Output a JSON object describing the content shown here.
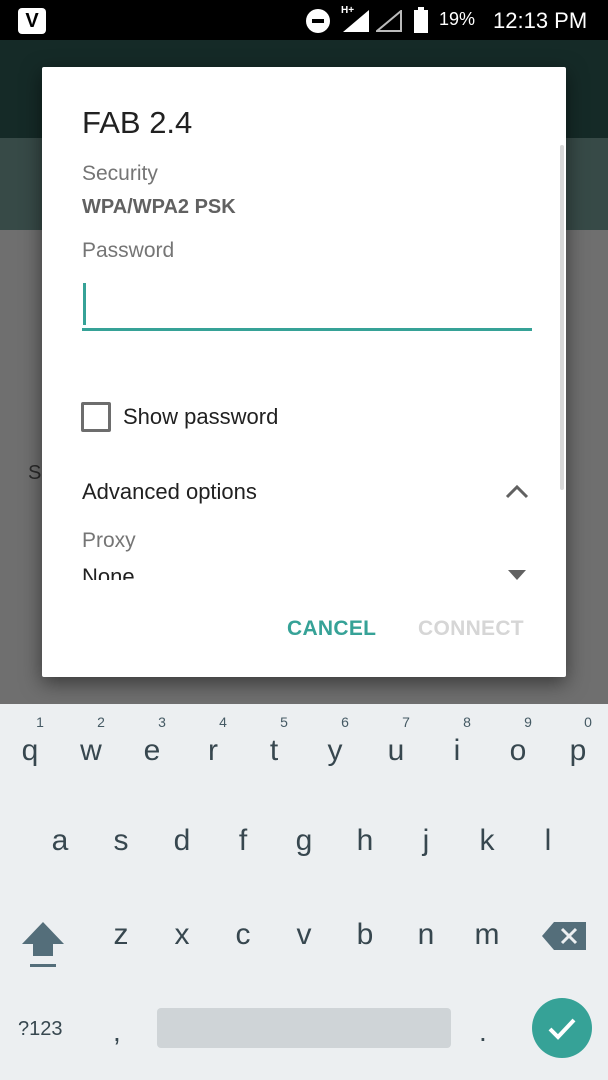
{
  "status_bar": {
    "app_badge": "V",
    "signal_label": "H+",
    "battery": "19%",
    "time": "12:13 PM"
  },
  "dialog": {
    "title": "FAB 2.4",
    "security_label": "Security",
    "security_value": "WPA/WPA2 PSK",
    "password_label": "Password",
    "password_value": "",
    "show_password_label": "Show password",
    "show_password_checked": false,
    "advanced_options_label": "Advanced options",
    "proxy_label": "Proxy",
    "proxy_value": "None",
    "cancel_label": "CANCEL",
    "connect_label": "CONNECT"
  },
  "keyboard": {
    "row1": [
      {
        "char": "q",
        "hint": "1"
      },
      {
        "char": "w",
        "hint": "2"
      },
      {
        "char": "e",
        "hint": "3"
      },
      {
        "char": "r",
        "hint": "4"
      },
      {
        "char": "t",
        "hint": "5"
      },
      {
        "char": "y",
        "hint": "6"
      },
      {
        "char": "u",
        "hint": "7"
      },
      {
        "char": "i",
        "hint": "8"
      },
      {
        "char": "o",
        "hint": "9"
      },
      {
        "char": "p",
        "hint": "0"
      }
    ],
    "row2": [
      "a",
      "s",
      "d",
      "f",
      "g",
      "h",
      "j",
      "k",
      "l"
    ],
    "row3": [
      "z",
      "x",
      "c",
      "v",
      "b",
      "n",
      "m"
    ],
    "symbols_label": "?123",
    "comma": ",",
    "period": "."
  },
  "colors": {
    "accent": "#36a297",
    "disabled": "#d6d6d6",
    "keyboard_bg": "#eceff1"
  }
}
